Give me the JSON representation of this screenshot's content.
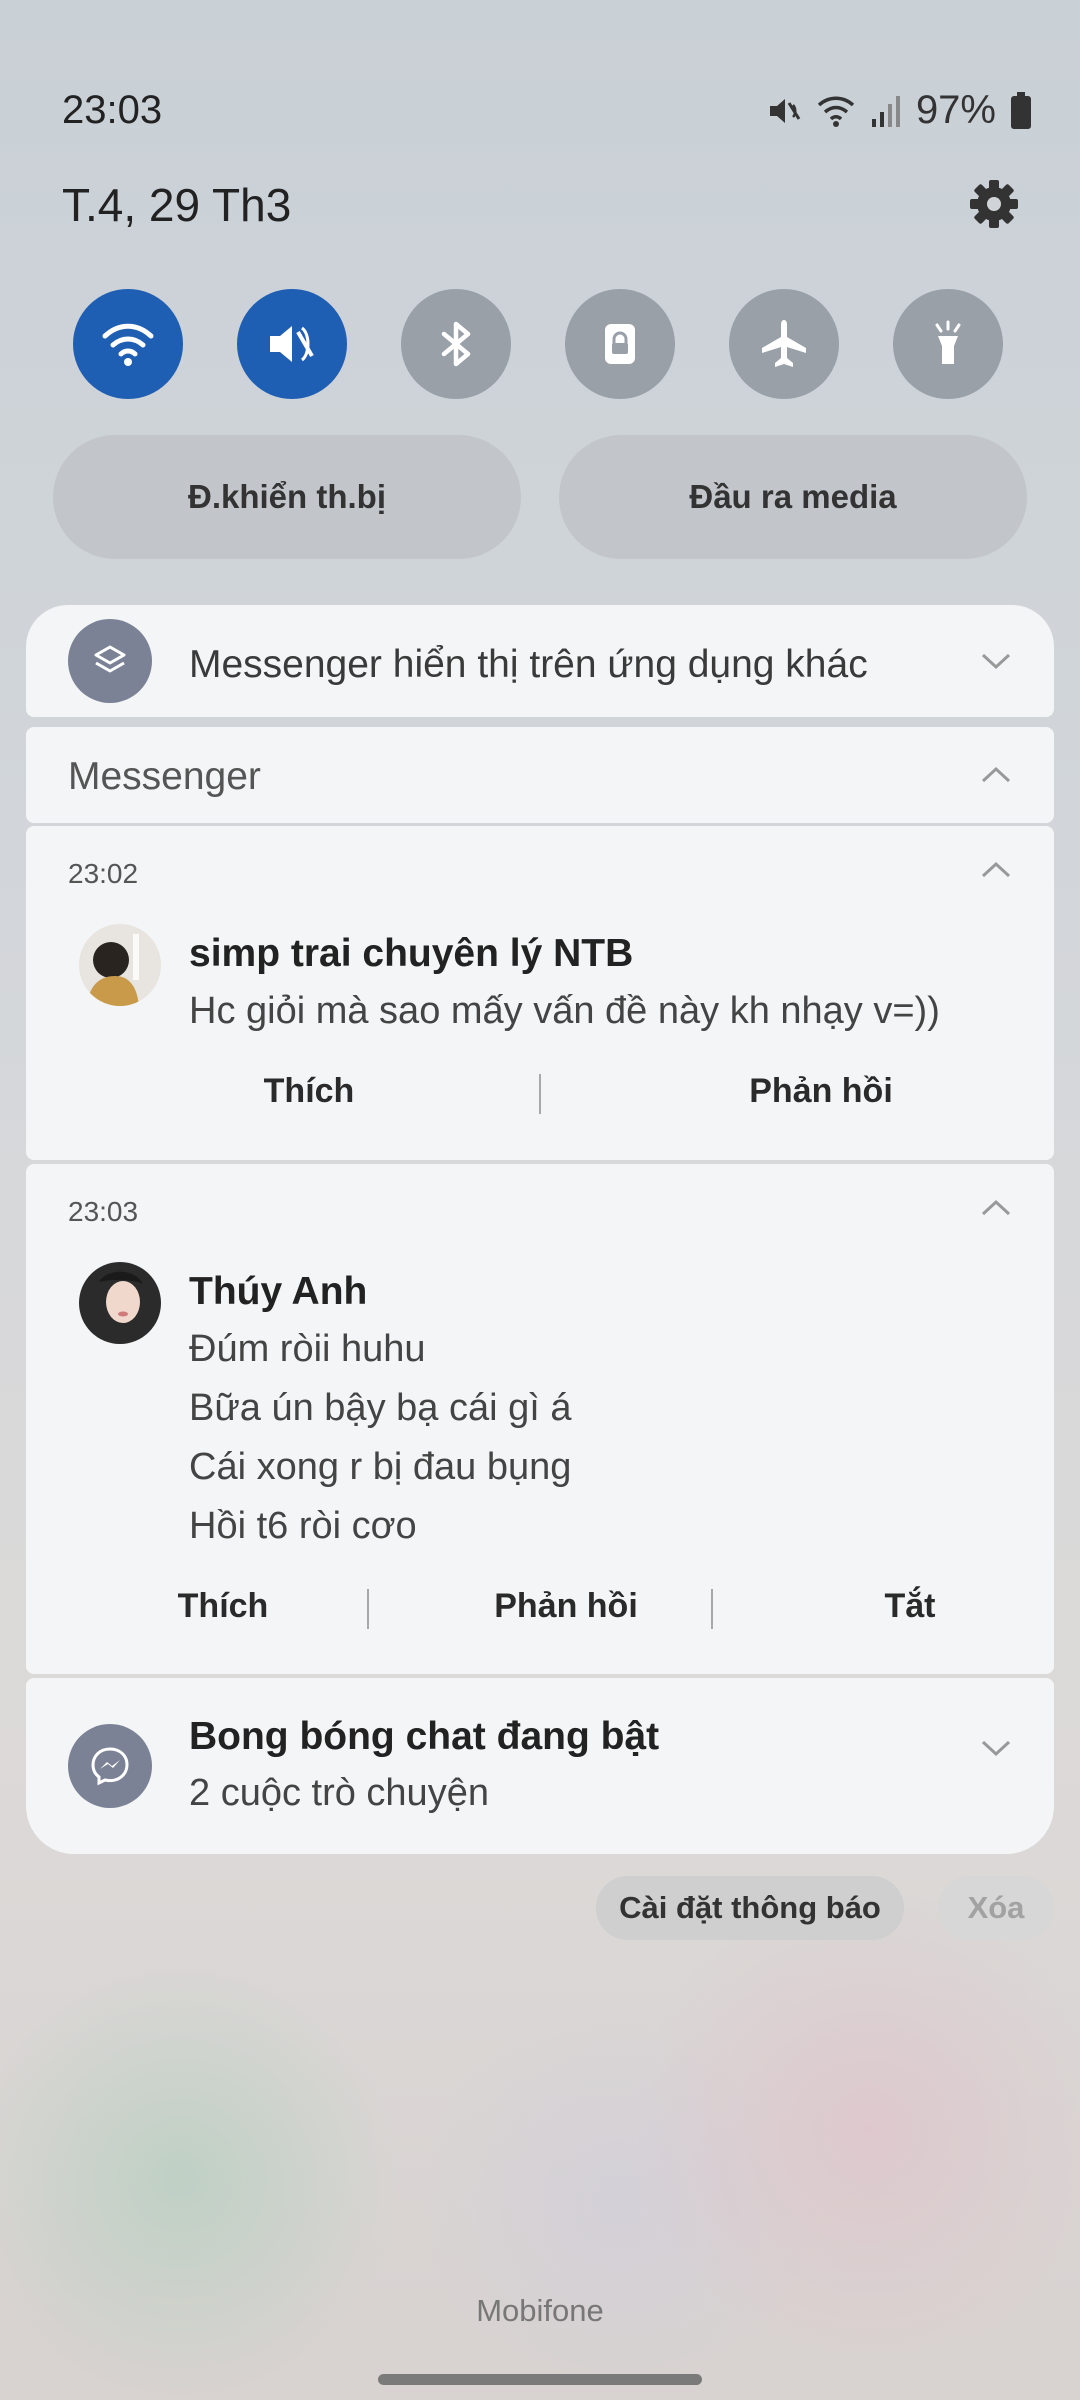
{
  "status_bar": {
    "time": "23:03",
    "battery": "97%",
    "icons": [
      "mute-icon",
      "wifi-icon",
      "signal-icon",
      "battery-icon"
    ]
  },
  "header": {
    "date": "T.4, 29 Th3"
  },
  "quick_toggles": [
    {
      "name": "wifi",
      "on": true
    },
    {
      "name": "sound-mute",
      "on": true
    },
    {
      "name": "bluetooth",
      "on": false
    },
    {
      "name": "screen-lock",
      "on": false
    },
    {
      "name": "airplane",
      "on": false
    },
    {
      "name": "flashlight",
      "on": false
    }
  ],
  "pills": {
    "device_control": "Đ.khiển th.bị",
    "media_output": "Đầu ra media"
  },
  "overlay_notice": {
    "text": "Messenger hiển thị trên ứng dụng khác"
  },
  "group": {
    "title": "Messenger"
  },
  "messages": [
    {
      "time": "23:02",
      "sender": "simp trai chuyên lý NTB",
      "lines": [
        "Hc giỏi mà sao mấy vấn đề này kh nhạy v=))"
      ],
      "actions": [
        "Thích",
        "Phản hồi"
      ]
    },
    {
      "time": "23:03",
      "sender": "Thúy Anh",
      "lines": [
        "Đúm ròii huhu",
        "Bữa ún bậy bạ cái gì á",
        "Cái xong r bị đau bụng",
        "Hồi t6 ròi cơo"
      ],
      "actions": [
        "Thích",
        "Phản hồi",
        "Tắt"
      ]
    }
  ],
  "bubbles": {
    "title": "Bong bóng chat đang bật",
    "subtitle": "2 cuộc trò chuyện"
  },
  "footer": {
    "settings_button": "Cài đặt thông báo",
    "clear_button": "Xóa",
    "carrier": "Mobifone"
  },
  "colors": {
    "toggle_on": "#1f5fb3",
    "toggle_off": "#9aa0a8",
    "card_bg": "#f4f5f6"
  }
}
